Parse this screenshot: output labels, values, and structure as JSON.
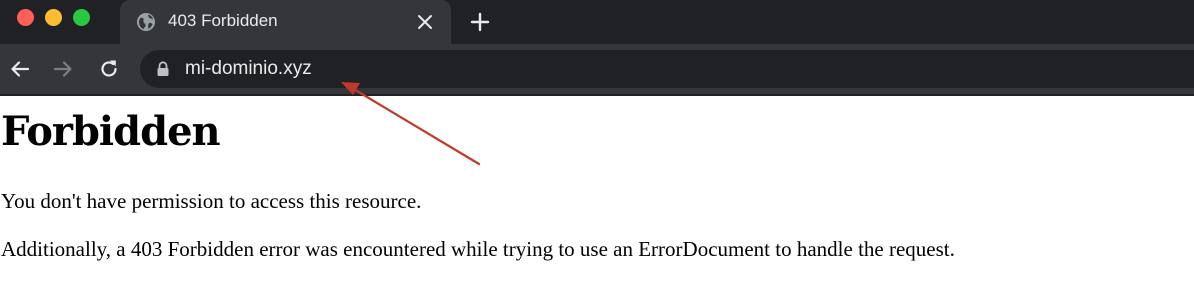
{
  "tab": {
    "title": "403 Forbidden",
    "favicon": "globe-icon",
    "close": "close-icon"
  },
  "toolbar": {
    "back": "arrow-left-icon",
    "forward": "arrow-right-icon",
    "reload": "reload-icon",
    "new_tab": "plus-icon"
  },
  "omnibox": {
    "lock": "lock-icon",
    "url": "mi-dominio.xyz"
  },
  "page": {
    "heading": "Forbidden",
    "line1": "You don't have permission to access this resource.",
    "line2": "Additionally, a 403 Forbidden error was encountered while trying to use an ErrorDocument to handle the request."
  },
  "colors": {
    "tabstrip": "#202124",
    "toolbar": "#35363a",
    "traffic_red": "#ff5f57",
    "traffic_yellow": "#febc2e",
    "traffic_green": "#28c840",
    "annotation_arrow": "#c0392b"
  }
}
